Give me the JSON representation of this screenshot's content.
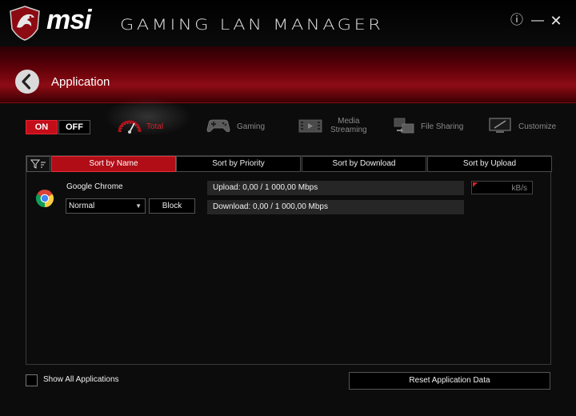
{
  "header": {
    "brand": "msi",
    "product": "GAMING LAN MANAGER",
    "info_glyph": "ⓘ",
    "minimize_glyph": "—",
    "close_glyph": "✕"
  },
  "page": {
    "title": "Application"
  },
  "toggle": {
    "on_label": "ON",
    "off_label": "OFF",
    "state": "on"
  },
  "categories": [
    {
      "label": "Total",
      "icon": "speedometer-icon",
      "active": true
    },
    {
      "label": "Gaming",
      "icon": "gamepad-icon",
      "active": false
    },
    {
      "label_line1": "Media",
      "label_line2": "Streaming",
      "icon": "film-icon",
      "active": false
    },
    {
      "label": "File Sharing",
      "icon": "file-sharing-icon",
      "active": false
    },
    {
      "label": "Customize",
      "icon": "monitor-icon",
      "active": false
    }
  ],
  "sort_tabs": [
    {
      "label": "Sort by Name",
      "active": true
    },
    {
      "label": "Sort by Priority",
      "active": false
    },
    {
      "label": "Sort by Download",
      "active": false
    },
    {
      "label": "Sort by Upload",
      "active": false
    }
  ],
  "apps": [
    {
      "name": "Google Chrome",
      "icon": "chrome-icon",
      "priority": "Normal",
      "block_label": "Block",
      "upload": "Upload: 0,00 / 1 000,00 Mbps",
      "download": "Download: 0,00 / 1 000,00 Mbps",
      "limit_unit": "kB/s"
    }
  ],
  "footer": {
    "show_all_label": "Show All Applications",
    "show_all_checked": false,
    "reset_label": "Reset Application Data"
  },
  "colors": {
    "accent": "#c20e19",
    "active_text": "#d8202b",
    "background": "#0c0c0c"
  }
}
